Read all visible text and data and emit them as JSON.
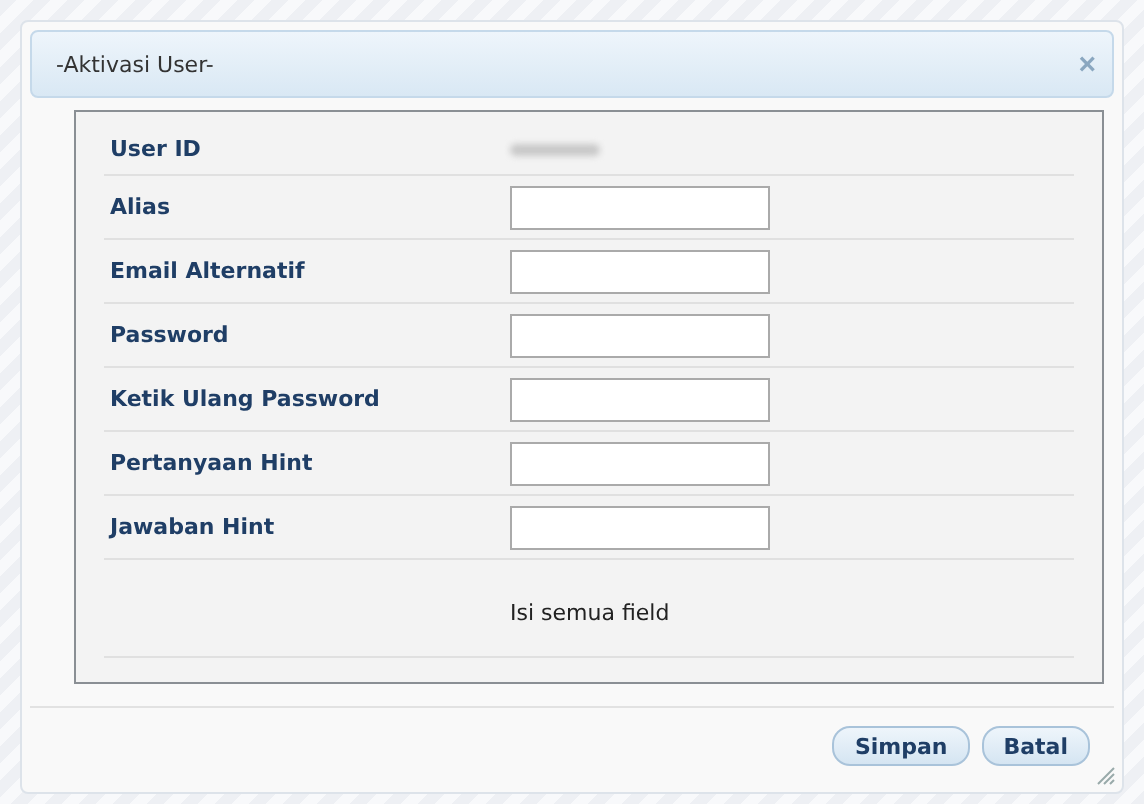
{
  "dialog": {
    "title": "-Aktivasi User-",
    "close": "×"
  },
  "rows": [
    {
      "kind": "readonly",
      "label": "User ID"
    },
    {
      "kind": "input",
      "label": "Alias"
    },
    {
      "kind": "input",
      "label": "Email Alternatif"
    },
    {
      "kind": "input",
      "label": "Password"
    },
    {
      "kind": "input",
      "label": "Ketik Ulang Password"
    },
    {
      "kind": "input",
      "label": "Pertanyaan Hint"
    },
    {
      "kind": "input",
      "label": "Jawaban Hint"
    }
  ],
  "message": "Isi semua field",
  "buttons": [
    "Simpan",
    "Batal"
  ]
}
